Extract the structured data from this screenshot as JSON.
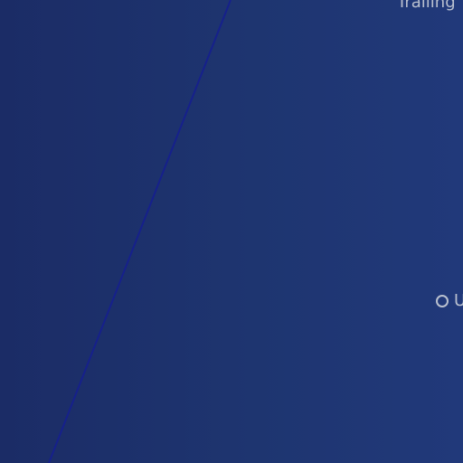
{
  "top_label": "Trailing",
  "radio_option": {
    "label": "U",
    "selected": false
  },
  "colors": {
    "background_left": "#1b2c66",
    "background_right": "#21397a",
    "line": "#16208c",
    "text": "#b9c0cf"
  }
}
